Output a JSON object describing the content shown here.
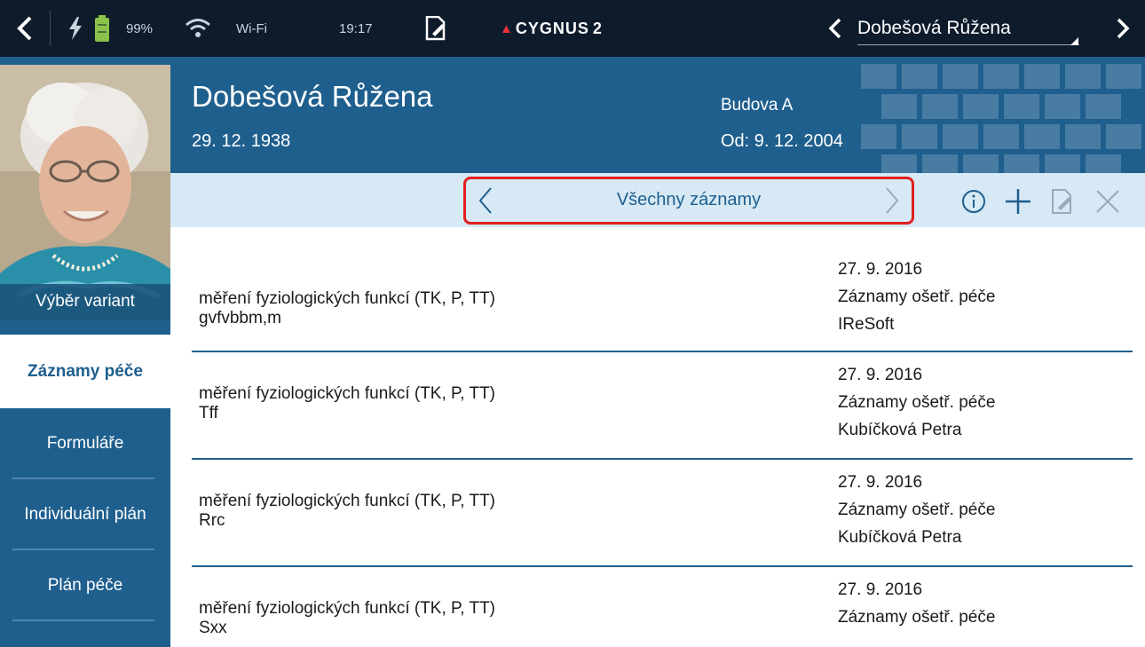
{
  "statusbar": {
    "battery_percent": "99%",
    "wifi_label": "Wi-Fi",
    "time": "19:17",
    "logo": "CYGNUS",
    "logo_suffix": "2",
    "current_patient": "Dobešová Růžena"
  },
  "sidebar": {
    "items": [
      {
        "label": "Výběr variant"
      },
      {
        "label": "Záznamy péče"
      },
      {
        "label": "Formuláře"
      },
      {
        "label": "Individuální plán"
      },
      {
        "label": "Plán péče"
      }
    ]
  },
  "header": {
    "name": "Dobešová Růžena",
    "dob": "29. 12. 1938",
    "building": "Budova A",
    "since": "Od: 9. 12. 2004"
  },
  "filter": {
    "label": "Všechny záznamy"
  },
  "records": [
    {
      "title": "měření fyziologických funkcí (TK, P, TT)",
      "note": "gvfvbbm,m",
      "date": "27. 9. 2016",
      "type": "Záznamy ošetř. péče",
      "author": "IReSoft"
    },
    {
      "title": "měření fyziologických funkcí (TK, P, TT)",
      "note": "Tff",
      "date": "27. 9. 2016",
      "type": "Záznamy ošetř. péče",
      "author": "Kubíčková Petra"
    },
    {
      "title": "měření fyziologických funkcí (TK, P, TT)",
      "note": "Rrc",
      "date": "27. 9. 2016",
      "type": "Záznamy ošetř. péče",
      "author": "Kubíčková Petra"
    },
    {
      "title": "měření fyziologických funkcí (TK, P, TT)",
      "note": "Sxx",
      "date": "27. 9. 2016",
      "type": "Záznamy ošetř. péče",
      "author": ""
    }
  ],
  "colors": {
    "statusbar_bg": "#0e1b2b",
    "primary_blue": "#1f5f8e",
    "filterbar_bg": "#d6e9f5",
    "highlight_red": "#e0201e",
    "battery_green": "#8bc34a"
  }
}
